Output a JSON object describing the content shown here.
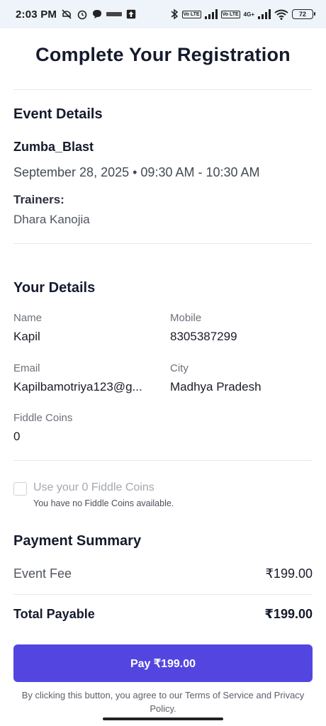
{
  "status_bar": {
    "time": "2:03 PM",
    "volte_tag": "Vo LTE",
    "network_tag": "4G+",
    "battery": "72"
  },
  "page": {
    "title": "Complete Your Registration"
  },
  "event_details": {
    "section_title": "Event Details",
    "event_name": "Zumba_Blast",
    "datetime": "September 28, 2025 • 09:30 AM - 10:30 AM",
    "trainers_label": "Trainers:",
    "trainers": "Dhara Kanojia"
  },
  "your_details": {
    "section_title": "Your Details",
    "name_label": "Name",
    "name": "Kapil",
    "mobile_label": "Mobile",
    "mobile": "8305387299",
    "email_label": "Email",
    "email": "Kapilbamotriya123@g...",
    "city_label": "City",
    "city": "Madhya Pradesh",
    "coins_label": "Fiddle Coins",
    "coins": "0"
  },
  "coins_option": {
    "checked": false,
    "label": "Use your 0 Fiddle Coins",
    "note": "You have no Fiddle Coins available."
  },
  "payment_summary": {
    "section_title": "Payment Summary",
    "fee_label": "Event Fee",
    "fee": "₹199.00",
    "total_label": "Total Payable",
    "total": "₹199.00"
  },
  "pay_button": {
    "label": "Pay ₹199.00",
    "color": "#5346e0"
  },
  "terms": {
    "text": "By clicking this button, you agree to our Terms of Service and Privacy Policy."
  }
}
